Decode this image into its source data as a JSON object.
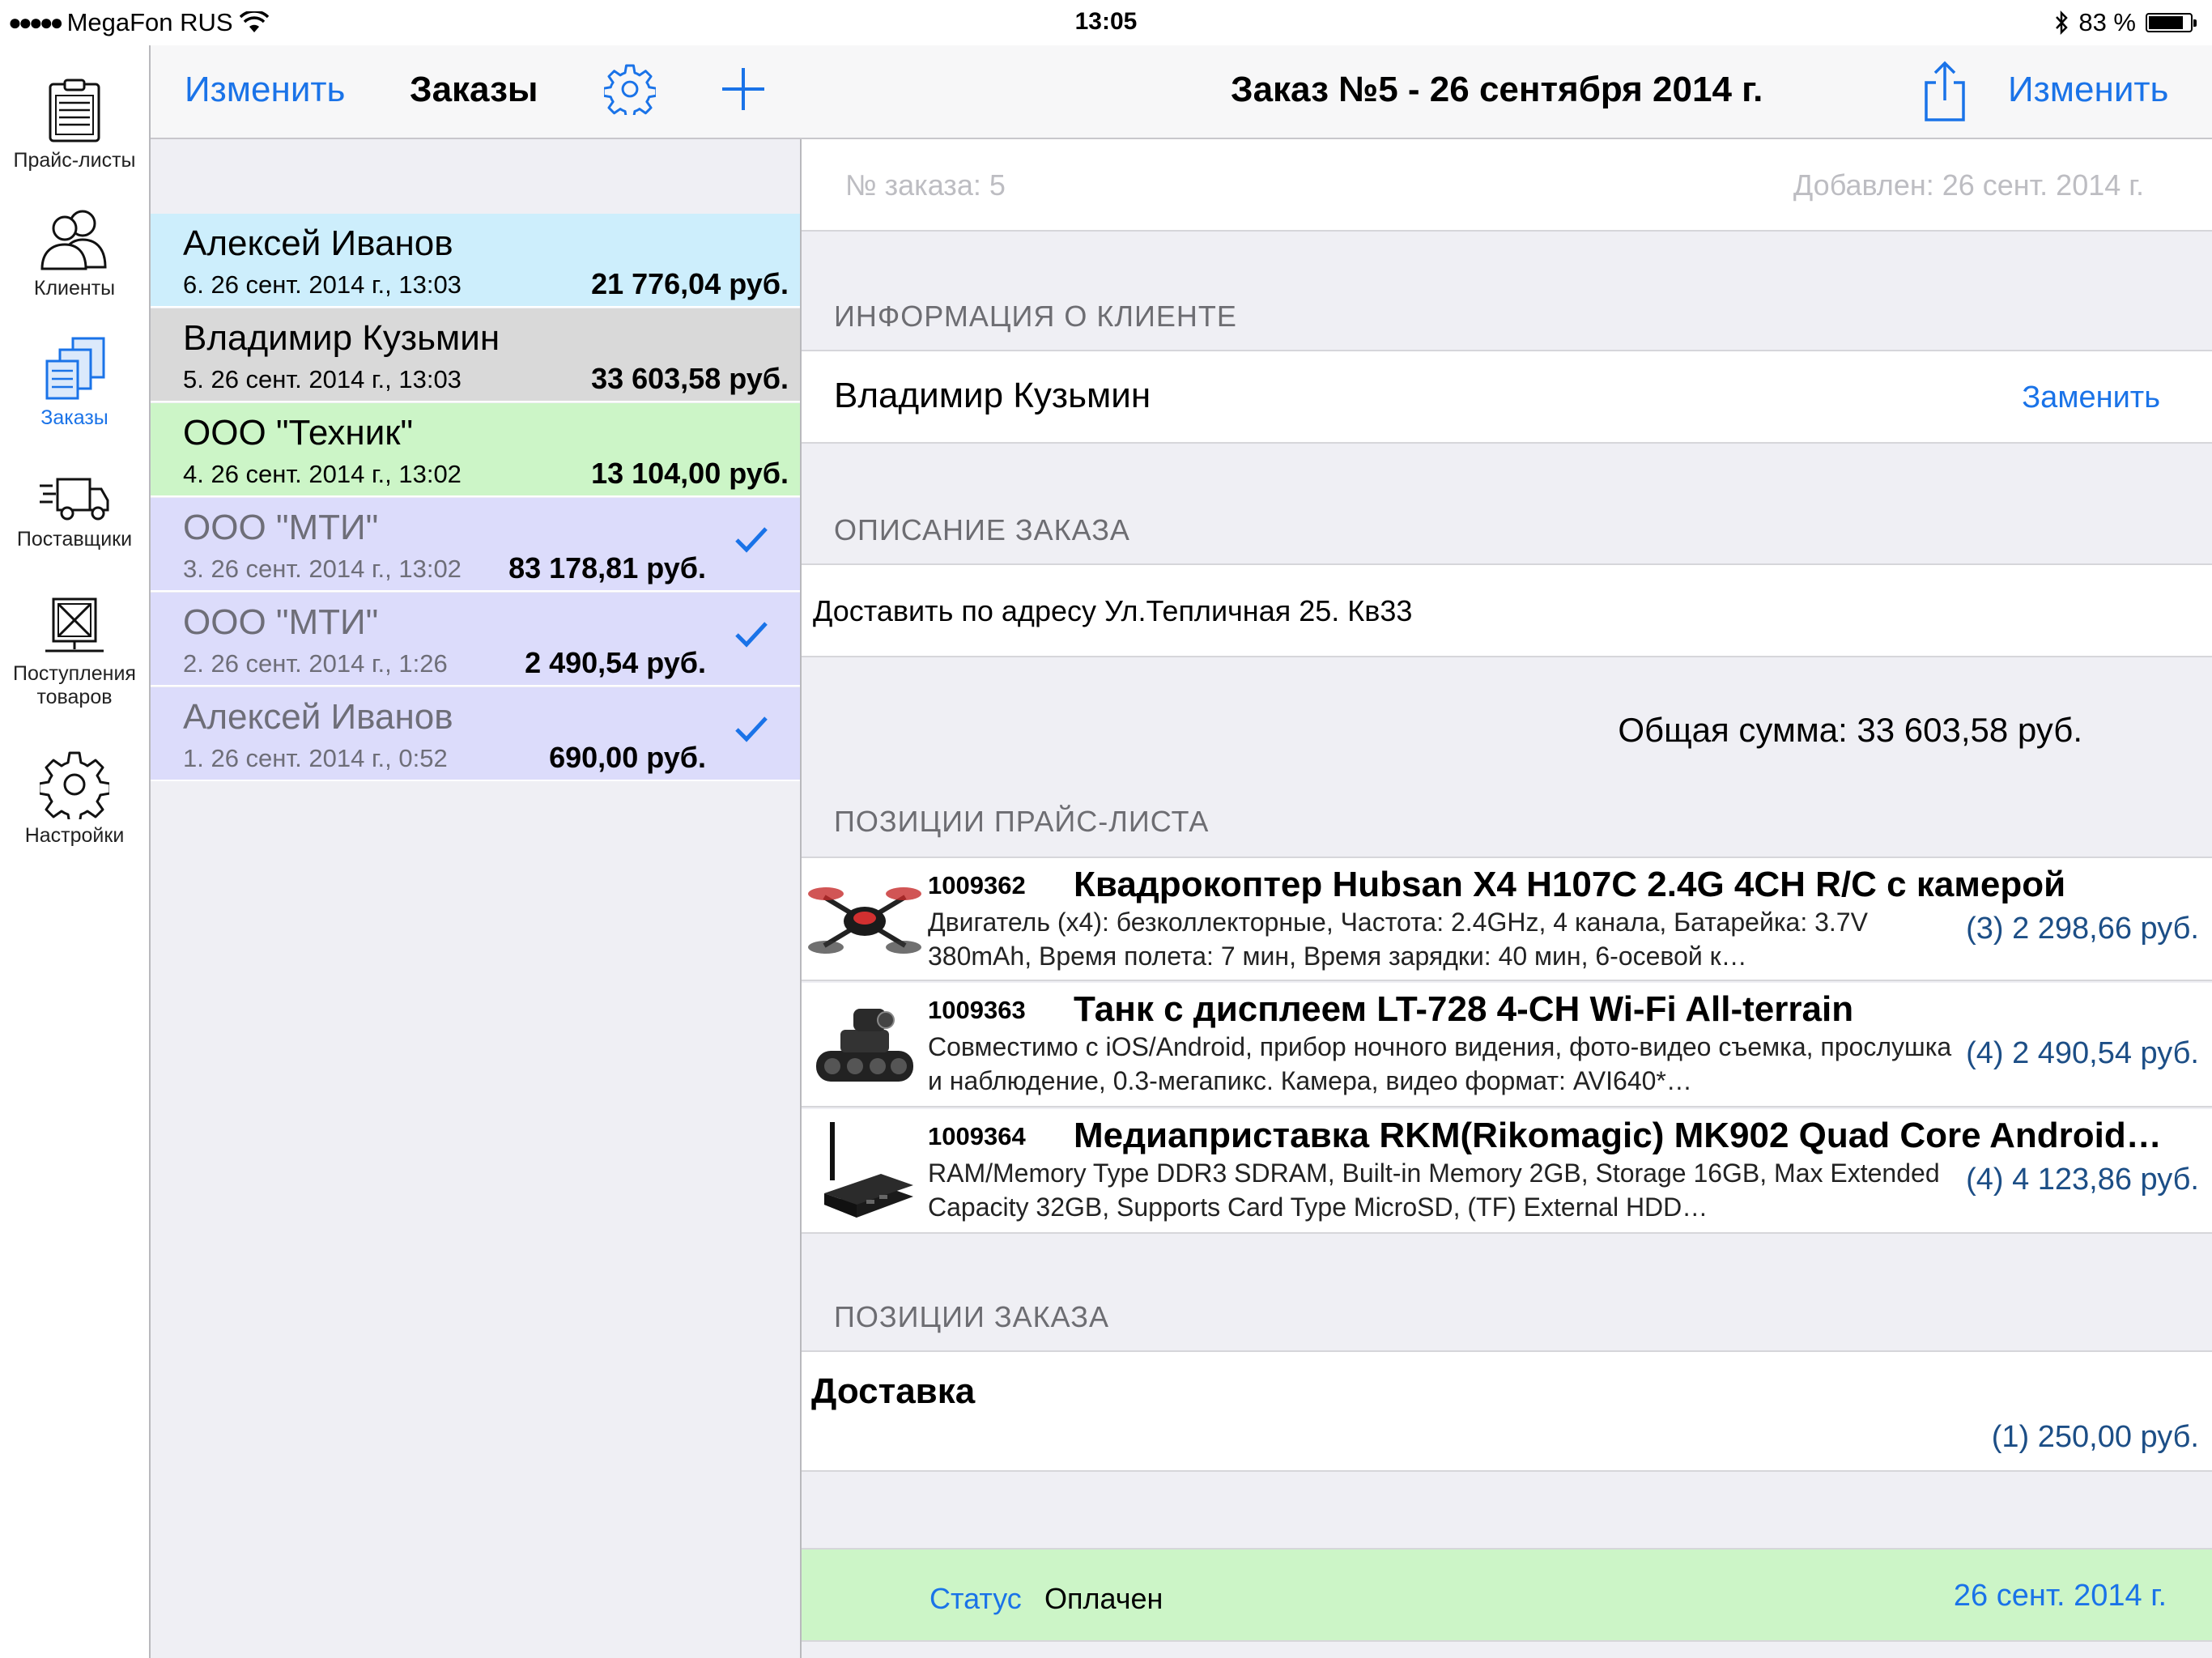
{
  "status_bar": {
    "carrier": "MegaFon RUS",
    "time": "13:05",
    "battery_text": "83 %",
    "battery_level": 0.83
  },
  "tabs": [
    {
      "label": "Прайс-листы",
      "icon": "clipboard-list-icon",
      "active": false
    },
    {
      "label": "Клиенты",
      "icon": "users-icon",
      "active": false
    },
    {
      "label": "Заказы",
      "icon": "orders-stack-icon",
      "active": true
    },
    {
      "label": "Поставщики",
      "icon": "delivery-truck-icon",
      "active": false
    },
    {
      "label_line1": "Поступления",
      "label_line2": "товаров",
      "icon": "goods-box-icon",
      "active": false
    },
    {
      "label": "Настройки",
      "icon": "gear-icon",
      "active": false
    }
  ],
  "master": {
    "edit_label": "Изменить",
    "title": "Заказы",
    "orders": [
      {
        "name": "Алексей Иванов",
        "meta": "6. 26 сент. 2014 г., 13:03",
        "sum": "21 776,04 руб.",
        "checked": false,
        "bg": "#cdeefc"
      },
      {
        "name": "Владимир Кузьмин",
        "meta": "5. 26 сент. 2014 г., 13:03",
        "sum": "33 603,58 руб.",
        "checked": false,
        "bg": "#d9d9d9"
      },
      {
        "name": "ООО \"Техник\"",
        "meta": "4. 26 сент. 2014 г., 13:02",
        "sum": "13 104,00 руб.",
        "checked": false,
        "bg": "#ccf5c7"
      },
      {
        "name": "ООО \"МТИ\"",
        "meta": "3. 26 сент. 2014 г., 13:02",
        "sum": "83 178,81 руб.",
        "checked": true,
        "bg": "#dcdcfb"
      },
      {
        "name": "ООО \"МТИ\"",
        "meta": "2. 26 сент. 2014 г., 1:26",
        "sum": "2 490,54 руб.",
        "checked": true,
        "bg": "#dcdcfb"
      },
      {
        "name": "Алексей Иванов",
        "meta": "1. 26 сент. 2014 г., 0:52",
        "sum": "690,00 руб.",
        "checked": true,
        "bg": "#dcdcfb"
      }
    ]
  },
  "detail": {
    "title": "Заказ №5 - 26 сентября 2014 г.",
    "edit_label": "Изменить",
    "order_number": "№ заказа: 5",
    "added": "Добавлен: 26 сент. 2014 г.",
    "client_header": "ИНФОРМАЦИЯ О КЛИЕНТЕ",
    "client_name": "Владимир Кузьмин",
    "replace_label": "Заменить",
    "desc_header": "ОПИСАНИЕ ЗАКАЗА",
    "description": "Доставить по адресу Ул.Тепличная 25. Кв33",
    "total": "Общая сумма: 33 603,58 руб.",
    "products_header": "ПОЗИЦИИ ПРАЙС-ЛИСТА",
    "products": [
      {
        "sku": "1009362",
        "title": "Квадрокоптер Hubsan X4 H107C 2.4G 4CH R/C с камерой",
        "desc": "Двигатель (x4): безколлекторные, Частота: 2.4GHz, 4 канала, Батарейка: 3.7V 380mAh, Время полета:  7 мин, Время зарядки: 40 мин,  6-осевой к…",
        "price": "(3) 2 298,66 руб."
      },
      {
        "sku": "1009363",
        "title": "Танк с дисплеем LT-728 4-CH Wi-Fi All-terrain",
        "desc": "Совместимо с iOS/Android, прибор ночного видения, фото-видео съемка, прослушка и наблюдение, 0.3-мегапикс. Камера, видео формат: AVI640*…",
        "price": "(4) 2 490,54 руб."
      },
      {
        "sku": "1009364",
        "title": "Медиаприставка RKM(Rikomagic) MK902 Quad Core Android…",
        "desc": "RAM/Memory Type DDR3 SDRAM, Built-in Memory 2GB, Storage 16GB, Max Extended Capacity 32GB, Supports Card Type MicroSD, (TF) External HDD…",
        "price": "(4) 4 123,86 руб."
      }
    ],
    "order_items_header": "ПОЗИЦИИ ЗАКАЗА",
    "order_item_title": "Доставка",
    "order_item_price": "(1) 250,00 руб.",
    "status_label": "Статус",
    "status_value": "Оплачен",
    "status_date": "26 сент. 2014 г."
  },
  "colors": {
    "accent": "#1a73e8",
    "price": "#1c4e86",
    "status_bg": "#ccf5c7"
  }
}
